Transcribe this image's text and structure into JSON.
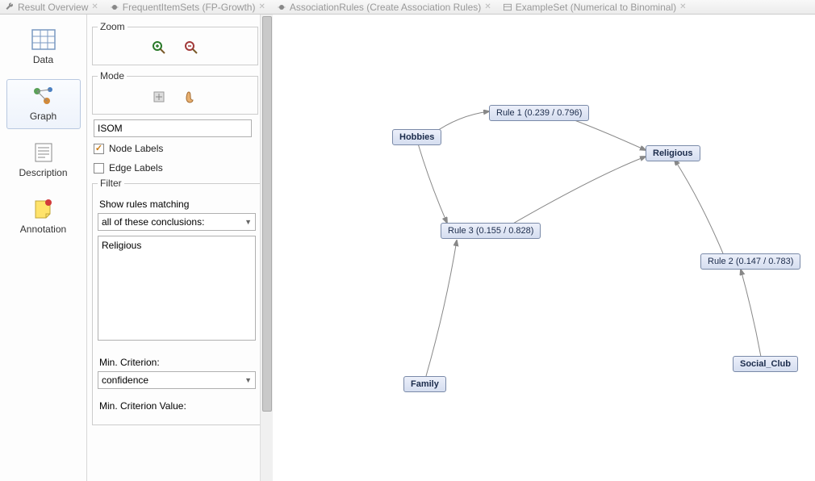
{
  "tabs": {
    "result_overview": "Result Overview",
    "frequent": "FrequentItemSets (FP-Growth)",
    "assoc": "AssociationRules (Create Association Rules)",
    "example": "ExampleSet (Numerical to Binominal)"
  },
  "views": {
    "data": "Data",
    "graph": "Graph",
    "description": "Description",
    "annotation": "Annotation"
  },
  "panels": {
    "zoom": "Zoom",
    "mode": "Mode",
    "filter": "Filter"
  },
  "layout_combo": "ISOM",
  "node_labels": "Node Labels",
  "edge_labels": "Edge Labels",
  "filter": {
    "show_rules": "Show rules matching",
    "conclusion_sel": "all of these conclusions:",
    "list_item": "Religious",
    "min_criterion_lbl": "Min. Criterion:",
    "min_criterion_val": "confidence",
    "min_value_lbl": "Min. Criterion Value:"
  },
  "graph": {
    "hobbies": "Hobbies",
    "religious": "Religious",
    "family": "Family",
    "social": "Social_Club",
    "rule1": "Rule 1 (0.239 / 0.796)",
    "rule2": "Rule 2 (0.147 / 0.783)",
    "rule3": "Rule 3 (0.155 / 0.828)"
  },
  "chart_data": {
    "type": "graph",
    "nodes": [
      {
        "id": "Hobbies",
        "kind": "item"
      },
      {
        "id": "Religious",
        "kind": "item"
      },
      {
        "id": "Family",
        "kind": "item"
      },
      {
        "id": "Social_Club",
        "kind": "item"
      },
      {
        "id": "Rule1",
        "kind": "rule",
        "support": 0.239,
        "confidence": 0.796
      },
      {
        "id": "Rule2",
        "kind": "rule",
        "support": 0.147,
        "confidence": 0.783
      },
      {
        "id": "Rule3",
        "kind": "rule",
        "support": 0.155,
        "confidence": 0.828
      }
    ],
    "edges": [
      {
        "from": "Hobbies",
        "to": "Rule1"
      },
      {
        "from": "Rule1",
        "to": "Religious"
      },
      {
        "from": "Hobbies",
        "to": "Rule3"
      },
      {
        "from": "Family",
        "to": "Rule3"
      },
      {
        "from": "Rule3",
        "to": "Religious"
      },
      {
        "from": "Social_Club",
        "to": "Rule2"
      },
      {
        "from": "Rule2",
        "to": "Religious"
      }
    ]
  }
}
